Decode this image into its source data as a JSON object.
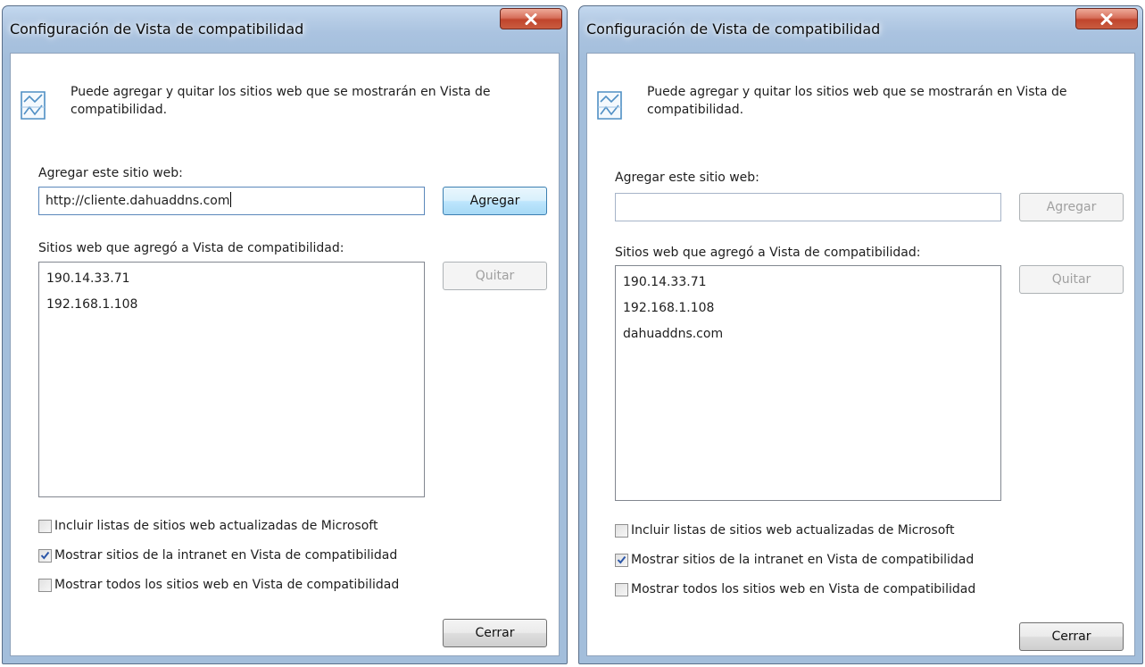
{
  "left_dialog": {
    "title": "Configuración de Vista de compatibilidad",
    "description": "Puede agregar y quitar los sitios web que se mostrarán en Vista de compatibilidad.",
    "add_label": "Agregar este sitio web:",
    "add_input_value": "http://cliente.dahuaddns.com",
    "add_button": "Agregar",
    "list_label": "Sitios web que agregó a Vista de compatibilidad:",
    "sites": [
      "190.14.33.71",
      "192.168.1.108"
    ],
    "remove_button": "Quitar",
    "checkboxes": [
      {
        "label": "Incluir listas de sitios web actualizadas de Microsoft",
        "checked": false
      },
      {
        "label": "Mostrar sitios de la intranet en Vista de compatibilidad",
        "checked": true
      },
      {
        "label": "Mostrar todos los sitios web en Vista de compatibilidad",
        "checked": false
      }
    ],
    "close_button": "Cerrar"
  },
  "right_dialog": {
    "title": "Configuración de Vista de compatibilidad",
    "description": "Puede agregar y quitar los sitios web que se mostrarán en Vista de compatibilidad.",
    "add_label": "Agregar este sitio web:",
    "add_input_value": "",
    "add_button": "Agregar",
    "list_label": "Sitios web que agregó a Vista de compatibilidad:",
    "sites": [
      "190.14.33.71",
      "192.168.1.108",
      "dahuaddns.com"
    ],
    "remove_button": "Quitar",
    "checkboxes": [
      {
        "label": "Incluir listas de sitios web actualizadas de Microsoft",
        "checked": false
      },
      {
        "label": "Mostrar sitios de la intranet en Vista de compatibilidad",
        "checked": true
      },
      {
        "label": "Mostrar todos los sitios web en Vista de compatibilidad",
        "checked": false
      }
    ],
    "close_button": "Cerrar"
  },
  "icons": {
    "close": "close-icon",
    "info": "compatibility-view-icon",
    "check": "checkmark-icon"
  },
  "colors": {
    "title_bar": "#b7cde6",
    "close_button": "#c7503a",
    "checkmark": "#2b56a8"
  }
}
